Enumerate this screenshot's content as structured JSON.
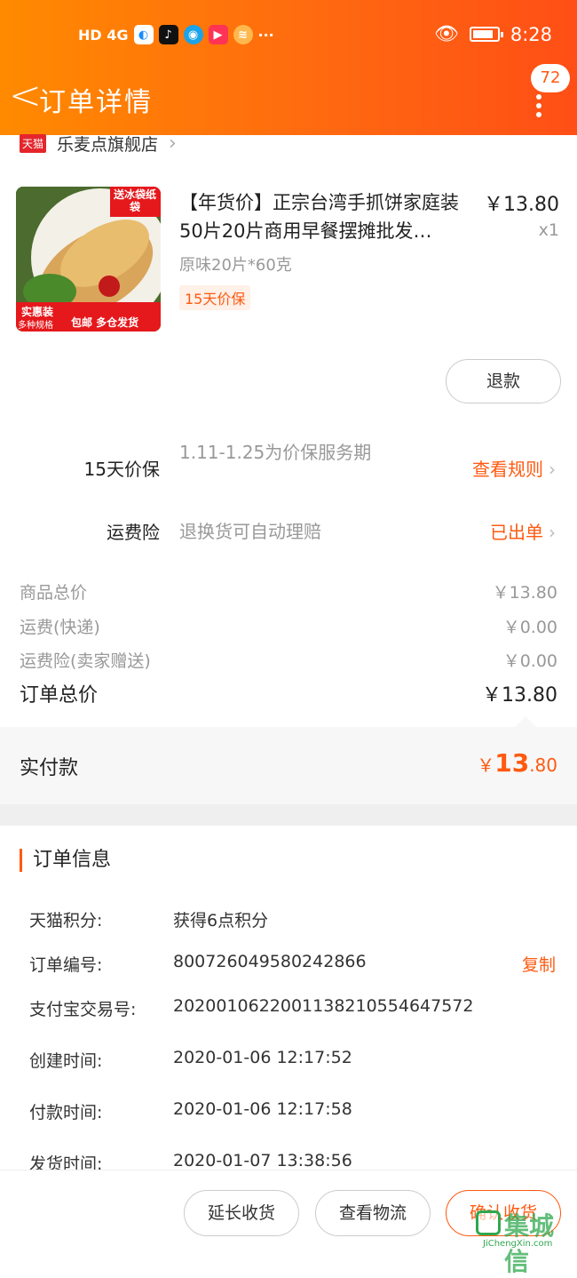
{
  "status_bar": {
    "indicators": "HD 4G",
    "dots": "···",
    "time": "8:28"
  },
  "nav": {
    "back_icon": "<",
    "title": "订单详情",
    "badge": "72"
  },
  "shop": {
    "tag": "天猫",
    "name": "乐麦点旗舰店"
  },
  "product": {
    "title": "【年货价】正宗台湾手抓饼家庭装50片20片商用早餐摆摊批发…",
    "price": "￥13.80",
    "qty": "x1",
    "spec": "原味20片*60克",
    "tag": "15天价保",
    "image_text": {
      "corner": "送冰袋纸袋",
      "left": "实惠装",
      "left_sub": "多种规格",
      "bottom": "包邮 多仓发货"
    },
    "refund_label": "退款"
  },
  "services": [
    {
      "label": "15天价保",
      "desc": "1.11-1.25为价保服务期",
      "link": "查看规则"
    },
    {
      "label": "运费险",
      "desc": "退换货可自动理赔",
      "link": "已出单"
    }
  ],
  "fees": [
    {
      "label": "商品总价",
      "value": "￥13.80"
    },
    {
      "label": "运费(快递)",
      "value": "￥0.00"
    },
    {
      "label": "运费险(卖家赠送)",
      "value": "￥0.00"
    }
  ],
  "total": {
    "label": "订单总价",
    "value": "￥13.80"
  },
  "paid": {
    "label": "实付款",
    "currency": "￥",
    "int": "13",
    "dec": ".80"
  },
  "order_info": {
    "heading": "订单信息",
    "copy_label": "复制",
    "rows": [
      {
        "key": "天猫积分:",
        "value": "获得6点积分"
      },
      {
        "key": "订单编号:",
        "value": "800726049580242866"
      },
      {
        "key": "支付宝交易号:",
        "value": "2020010622001138210554647572"
      },
      {
        "key": "创建时间:",
        "value": "2020-01-06 12:17:52"
      },
      {
        "key": "付款时间:",
        "value": "2020-01-06 12:17:58"
      },
      {
        "key": "发货时间:",
        "value": "2020-01-07 13:38:56"
      }
    ]
  },
  "actions": {
    "extend": "延长收货",
    "logistics": "查看物流",
    "confirm": "确认收货"
  },
  "watermark": {
    "text": "集城信",
    "url": "JiChengXin.com"
  }
}
